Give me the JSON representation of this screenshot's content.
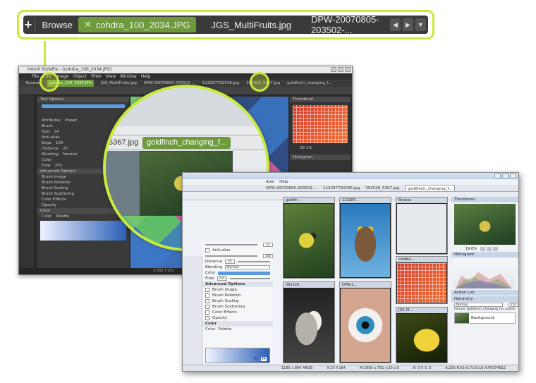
{
  "callout": {
    "add_label": "+",
    "browse_label": "Browse",
    "active_tab": "cohdra_100_2034.JPG",
    "close_glyph": "✕",
    "tab2": "JGS_MultiFruits.jpg",
    "tab3": "DPW-20070805-203502-...",
    "nav_prev": "◀",
    "nav_next": "▶",
    "nav_menu": "▼"
  },
  "dark_window": {
    "title": "Hornil StylePix - [cohdra_100_2034.JPG]",
    "menu": [
      "File",
      "Edit",
      "Image",
      "Object",
      "Filter",
      "View",
      "Window",
      "Help"
    ],
    "tabs": [
      "Browse",
      "cohdra_100_2034.JPG",
      "JGS_MultiFruits.jpg",
      "DPW-20070805-203502-...",
      "113287792036.jpg",
      "391526_5367.jpg",
      "goldfinch_changing_f..."
    ],
    "panel": {
      "tool_options": "Tool Options",
      "attributes": "Attributes",
      "preset": "Preset",
      "brush": "Brush",
      "size_label": "Size",
      "size_value": "14",
      "anti_alias": "Anti-alias",
      "edge_label": "Edge",
      "edge_value": "100",
      "distance_label": "Distance",
      "distance_value": "25",
      "blending_label": "Blending",
      "blending_value": "Normal",
      "color_label": "Color",
      "flow_label": "Flow",
      "flow_value": "255",
      "advanced": "Advanced Options",
      "adv_items": [
        "Brush Image",
        "Brush Rotation",
        "Brush Scaling",
        "Brush Scattering",
        "Color Effects",
        "Opacity"
      ],
      "color_section": "Color",
      "color_tab": "Color",
      "palette_tab": "Palette"
    },
    "right": {
      "thumbnail": "Thumbnail",
      "zoom": "28.1%",
      "histogram": "Histogram"
    },
    "status": "X:582 Y:251"
  },
  "magnifier": {
    "tab1": "5367.jpg",
    "tab2": "goldfinch_changing_f..."
  },
  "light_window": {
    "menu": [
      "dow",
      "Help"
    ],
    "tabs": [
      "DPW-20070805-203502-...",
      "113287792036.jpg",
      "391526_5367.jpg",
      "goldfinch_changing_f..."
    ],
    "panel": {
      "size_value": "14",
      "anti_alias": "Anti-alias",
      "edge_value": "100",
      "distance_label": "Distance",
      "distance_value": "25",
      "blending_label": "Blending",
      "blending_value": "Normal",
      "color_label": "Color",
      "flow_label": "Flow",
      "flow_value": "255",
      "advanced": "Advanced Options",
      "adv_items": [
        "Brush Image",
        "Brush Rotation",
        "Brush Scaling",
        "Brush Scattering",
        "Color Effects",
        "Opacity"
      ],
      "color_section": "Color",
      "color_tab": "Color",
      "palette_tab": "Palette",
      "b_label": "B",
      "b_value": "94"
    },
    "thumbs": {
      "c1": "goldfin...",
      "c2": "113287...",
      "c3": "Browse",
      "c4": "cohdra...",
      "c5": "391526...",
      "c6": "DPW-2...",
      "c7": "JGS_M..."
    },
    "right": {
      "thumbnail": "Thumbnail",
      "zoom": "19.6%",
      "histogram": "Histogram",
      "action_list": "Action List",
      "hierarchy": "Hierarchy",
      "blend": "Normal",
      "opacity": "250",
      "picture": "Picture 'goldfinch_changing_for_summ",
      "layer": "Background"
    },
    "status": {
      "size": "1185 x 894 ARGB",
      "xy": "X:20 Y:164",
      "m": "M:1685 x:751 y:20 z:0",
      "r": "R: 0 0 0, 0",
      "a": "A:255 R:55 G:72 B:18 X:FF374812"
    }
  }
}
